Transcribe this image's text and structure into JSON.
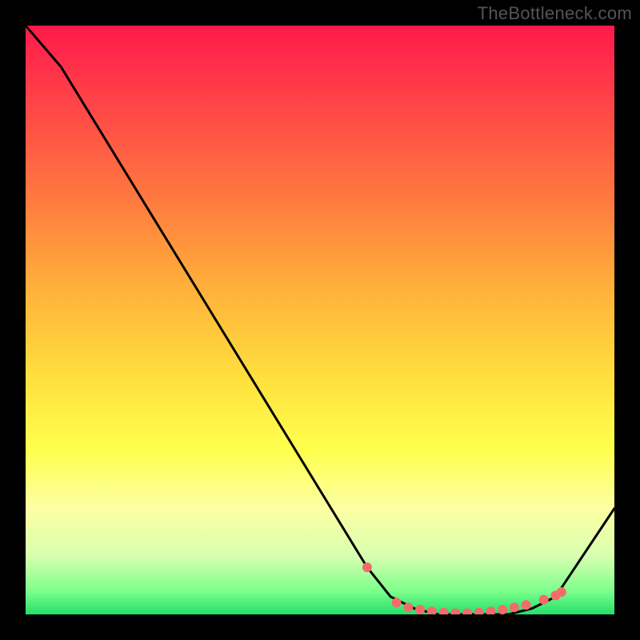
{
  "watermark": "TheBottleneck.com",
  "gradient": {
    "stops": [
      {
        "offset": 0.0,
        "color": "#ff1a4b"
      },
      {
        "offset": 0.15,
        "color": "#ff4a47"
      },
      {
        "offset": 0.3,
        "color": "#ff7b3f"
      },
      {
        "offset": 0.45,
        "color": "#ffb23a"
      },
      {
        "offset": 0.6,
        "color": "#ffe03e"
      },
      {
        "offset": 0.72,
        "color": "#ffff4d"
      },
      {
        "offset": 0.82,
        "color": "#fcffa3"
      },
      {
        "offset": 0.9,
        "color": "#d9ffb0"
      },
      {
        "offset": 0.96,
        "color": "#7dff8c"
      },
      {
        "offset": 1.0,
        "color": "#22e06a"
      }
    ]
  },
  "chart_data": {
    "type": "line",
    "title": "",
    "xlabel": "",
    "ylabel": "",
    "xlim": [
      0,
      100
    ],
    "ylim": [
      0,
      100
    ],
    "x": [
      0,
      6,
      58,
      62,
      66,
      70,
      74,
      78,
      82,
      86,
      90,
      100
    ],
    "series": [
      {
        "name": "curve",
        "values": [
          100,
          93,
          8,
          3,
          1,
          0,
          0,
          0,
          0,
          1,
          3,
          18
        ]
      }
    ],
    "markers": {
      "x": [
        58,
        63,
        65,
        67,
        69,
        71,
        73,
        75,
        77,
        79,
        81,
        83,
        85,
        88,
        90,
        91
      ],
      "values": [
        8,
        2,
        1.2,
        0.8,
        0.5,
        0.3,
        0.2,
        0.2,
        0.3,
        0.5,
        0.8,
        1.2,
        1.6,
        2.5,
        3.2,
        3.8
      ],
      "color": "#f36b6b",
      "radius": 6
    }
  }
}
